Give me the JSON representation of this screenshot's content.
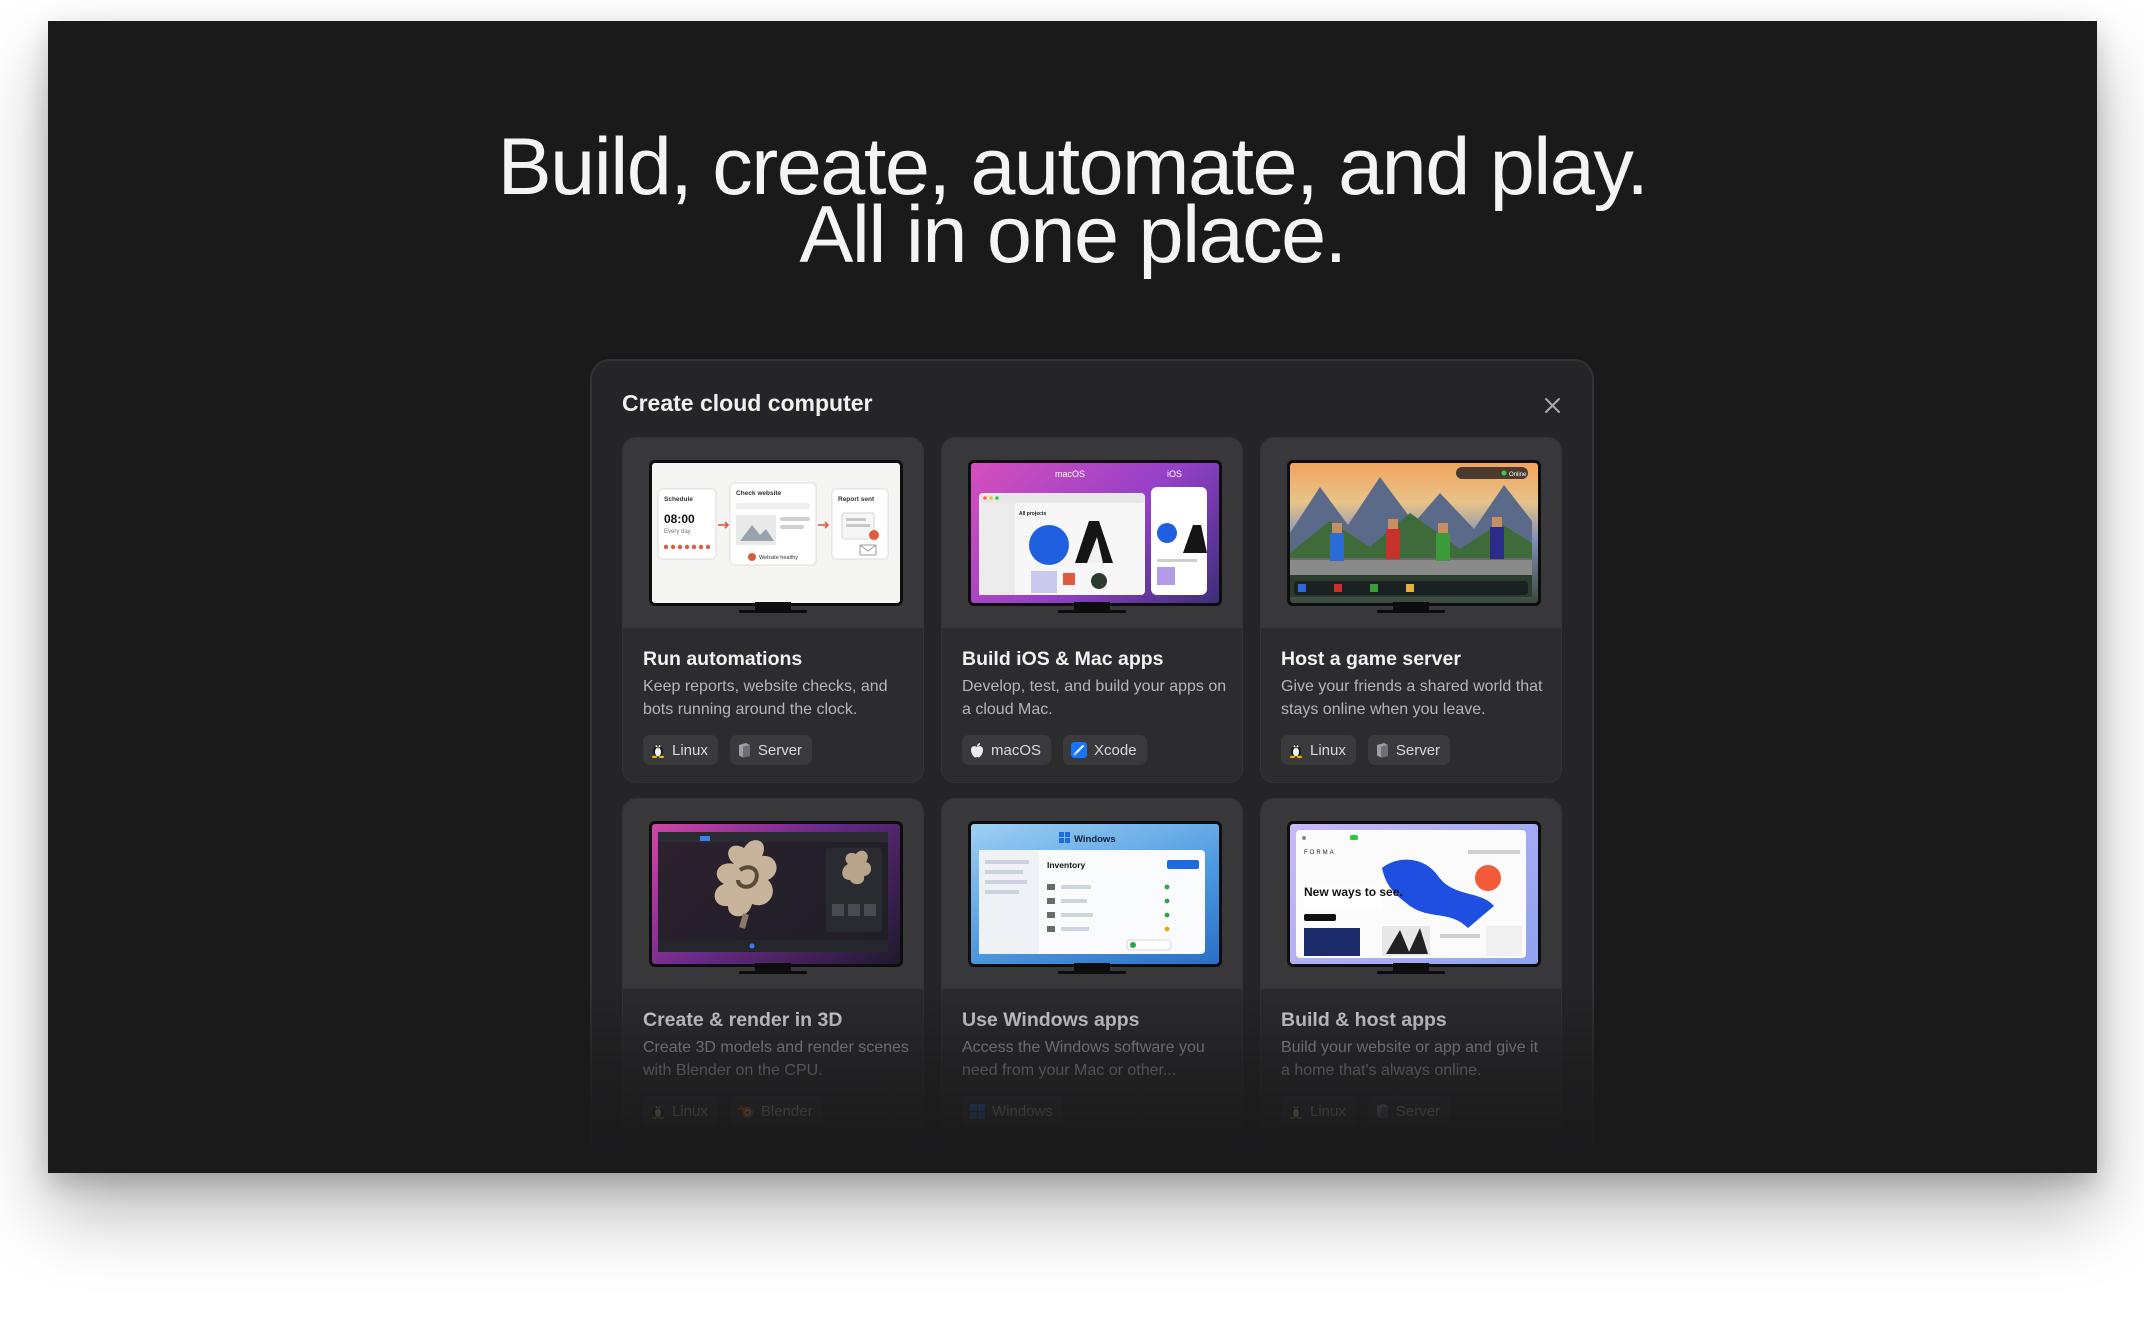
{
  "hero": {
    "line1": "Build, create, automate, and play.",
    "line2": "All in one place."
  },
  "modal": {
    "title": "Create cloud computer",
    "close_icon": "close-icon"
  },
  "cards": [
    {
      "title": "Run automations",
      "desc": "Keep reports, website checks, and bots running around the clock.",
      "thumb": {
        "schedule": "Schedule",
        "time": "08:00",
        "every": "Every day",
        "check": "Check website",
        "healthy": "Website healthy",
        "report": "Report sent"
      },
      "tags": [
        {
          "label": "Linux",
          "icon": "linux-icon"
        },
        {
          "label": "Server",
          "icon": "server-icon"
        }
      ]
    },
    {
      "title": "Build iOS & Mac apps",
      "desc": "Develop, test, and build your apps on a cloud Mac.",
      "thumb": {
        "macos": "macOS",
        "ios": "iOS",
        "projects": "All projects"
      },
      "tags": [
        {
          "label": "macOS",
          "icon": "apple-icon"
        },
        {
          "label": "Xcode",
          "icon": "xcode-icon"
        }
      ]
    },
    {
      "title": "Host a game server",
      "desc": "Give your friends a shared world that stays online when you leave.",
      "thumb": {
        "status": "Online"
      },
      "tags": [
        {
          "label": "Linux",
          "icon": "linux-icon"
        },
        {
          "label": "Server",
          "icon": "server-icon"
        }
      ]
    },
    {
      "title": "Create & render in 3D",
      "desc": "Create 3D models and render scenes with Blender on the CPU.",
      "thumb": {},
      "tags": [
        {
          "label": "Linux",
          "icon": "linux-icon"
        },
        {
          "label": "Blender",
          "icon": "blender-icon"
        }
      ]
    },
    {
      "title": "Use Windows apps",
      "desc": "Access the Windows software you need from your Mac or other...",
      "thumb": {
        "windows": "Windows",
        "inventory": "Inventory"
      },
      "tags": [
        {
          "label": "Windows",
          "icon": "windows-icon"
        }
      ]
    },
    {
      "title": "Build & host apps",
      "desc": "Build your website or app and give it a home that's always online.",
      "thumb": {
        "brand": "FORMA",
        "headline": "New ways to see."
      },
      "tags": [
        {
          "label": "Linux",
          "icon": "linux-icon"
        },
        {
          "label": "Server",
          "icon": "server-icon"
        }
      ]
    }
  ]
}
